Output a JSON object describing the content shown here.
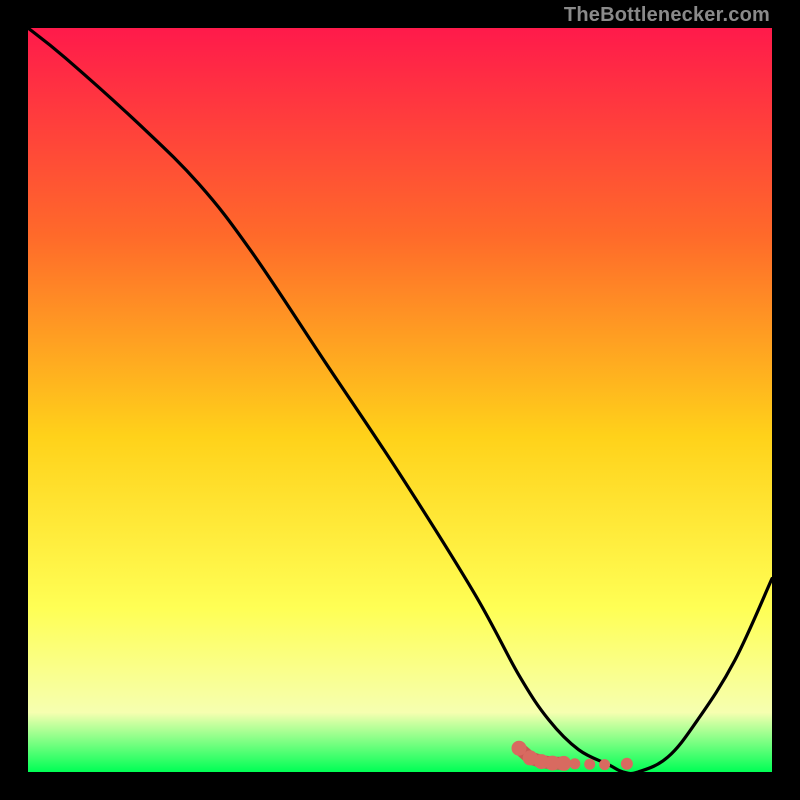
{
  "watermark": "TheBottlenecker.com",
  "colors": {
    "top": "#ff1a4b",
    "mid_upper": "#ff6a2a",
    "mid": "#ffd21a",
    "mid_lower": "#ffff55",
    "lower": "#f6ffb0",
    "bottom": "#00ff55",
    "curve_stroke": "#000000",
    "marker": "#d86a60",
    "marker_joint": "#c95a53"
  },
  "chart_data": {
    "type": "line",
    "title": "",
    "xlabel": "",
    "ylabel": "",
    "xlim": [
      0,
      100
    ],
    "ylim": [
      0,
      100
    ],
    "series": [
      {
        "name": "bottleneck-curve",
        "x": [
          0,
          5,
          15,
          23,
          30,
          40,
          50,
          60,
          66,
          70,
          74,
          78,
          80,
          82,
          86,
          90,
          95,
          100
        ],
        "y": [
          100,
          96,
          87,
          79,
          70,
          55,
          40,
          24,
          13,
          7,
          3,
          1,
          0,
          0,
          2,
          7,
          15,
          26
        ]
      }
    ],
    "markers": {
      "name": "highlight-cluster",
      "points": [
        {
          "x": 66,
          "y": 3.2
        },
        {
          "x": 67.5,
          "y": 1.9
        },
        {
          "x": 69,
          "y": 1.4
        },
        {
          "x": 70.5,
          "y": 1.2
        },
        {
          "x": 72,
          "y": 1.15
        },
        {
          "x": 73.5,
          "y": 1.1
        },
        {
          "x": 75.5,
          "y": 1.05
        },
        {
          "x": 77.5,
          "y": 1.0
        },
        {
          "x": 80.5,
          "y": 1.1
        }
      ]
    },
    "annotations": [
      "TheBottlenecker.com"
    ]
  }
}
